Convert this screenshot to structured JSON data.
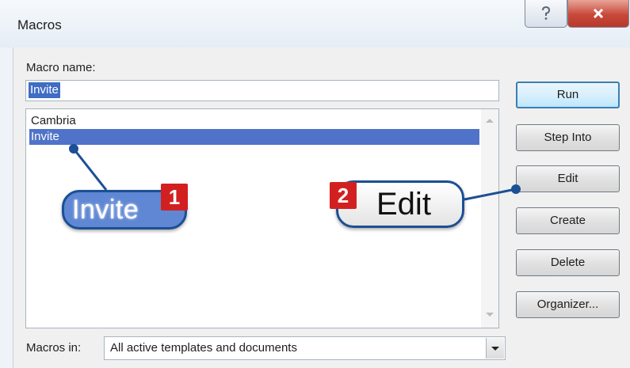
{
  "window": {
    "title": "Macros"
  },
  "titlebar": {
    "help_icon": "question-icon",
    "close_icon": "close-icon"
  },
  "macro_name": {
    "label": "Macro name:",
    "value": "Invite"
  },
  "macro_list": {
    "items": [
      "Cambria",
      "Invite"
    ],
    "selected": "Invite"
  },
  "buttons": {
    "run": "Run",
    "step_into": "Step Into",
    "edit": "Edit",
    "create": "Create",
    "delete": "Delete",
    "organizer": "Organizer..."
  },
  "macros_in": {
    "label": "Macros in:",
    "value": "All active templates and documents"
  },
  "callouts": [
    {
      "number": "1",
      "text": "Invite"
    },
    {
      "number": "2",
      "text": "Edit"
    }
  ],
  "colors": {
    "callout_border": "#1c4f94",
    "badge": "#d22020",
    "selection": "#4f73c8"
  }
}
